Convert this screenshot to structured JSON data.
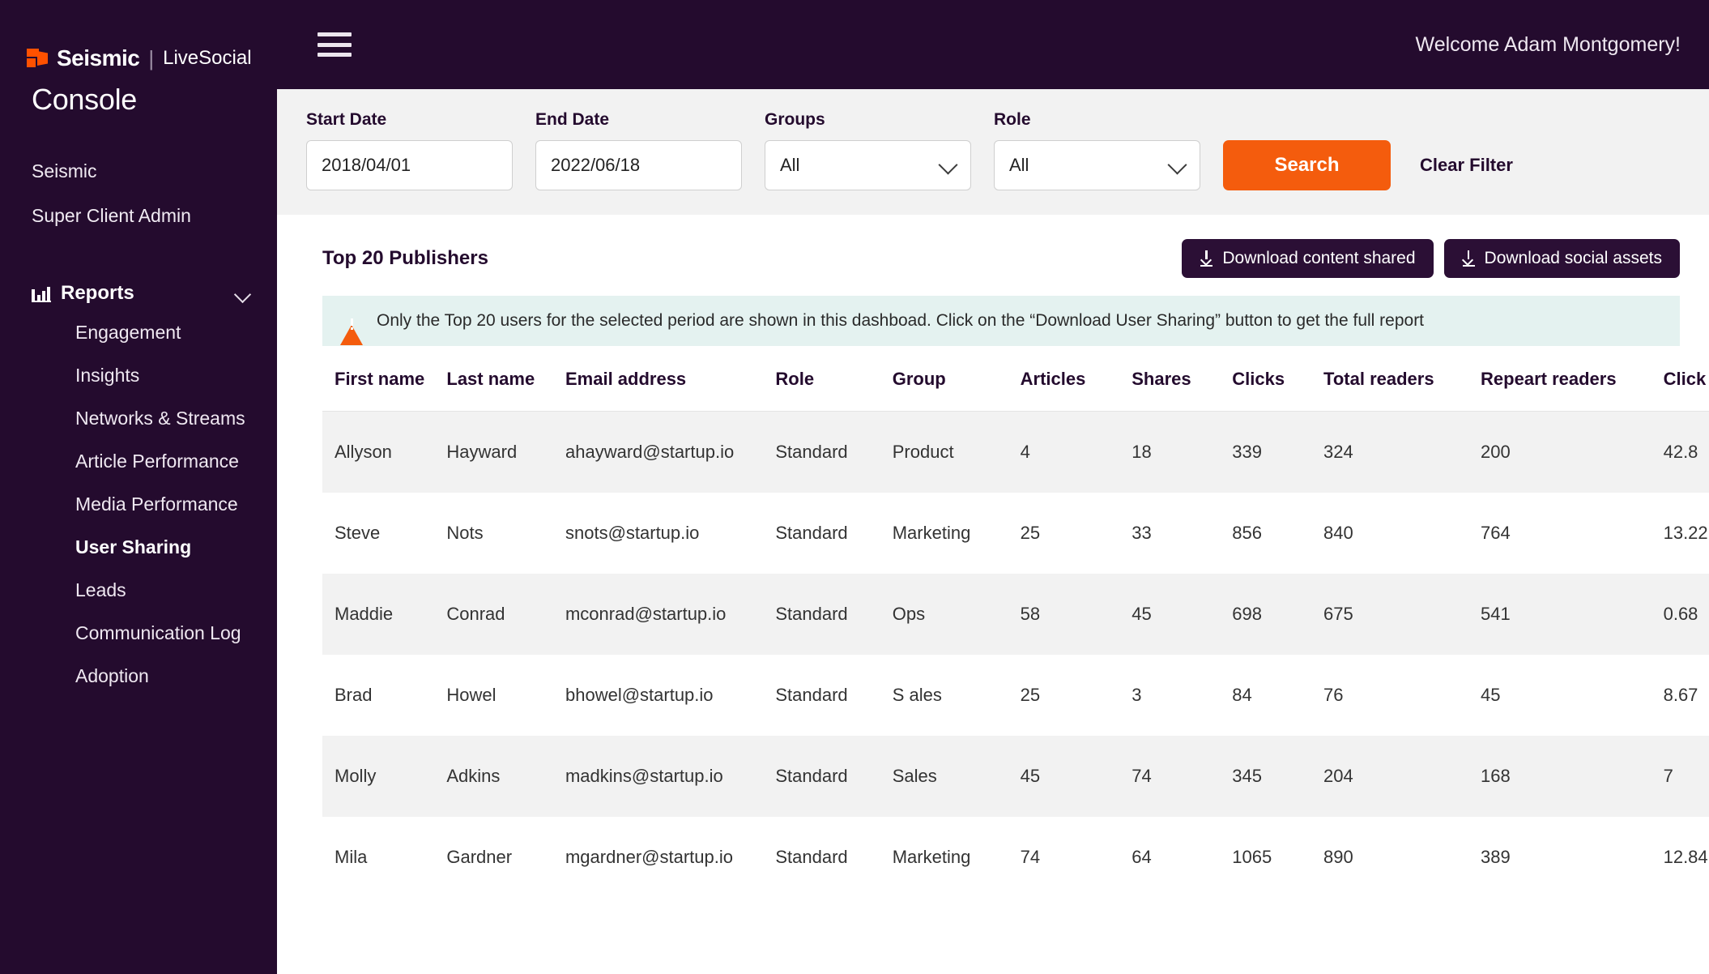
{
  "brand": {
    "name": "Seismic",
    "divider": "|",
    "product": "LiveSocial",
    "console": "Console"
  },
  "sidebar": {
    "top_items": [
      {
        "label": "Seismic"
      },
      {
        "label": "Super Client Admin"
      }
    ],
    "section": {
      "label": "Reports",
      "icon": "bar-chart-icon",
      "chevron": "chevron-down-icon"
    },
    "sub_items": [
      {
        "label": "Engagement",
        "active": false
      },
      {
        "label": "Insights",
        "active": false
      },
      {
        "label": "Networks & Streams",
        "active": false
      },
      {
        "label": "Article Performance",
        "active": false
      },
      {
        "label": "Media Performance",
        "active": false
      },
      {
        "label": "User Sharing",
        "active": true
      },
      {
        "label": "Leads",
        "active": false
      },
      {
        "label": "Communication Log",
        "active": false
      },
      {
        "label": "Adoption",
        "active": false
      }
    ]
  },
  "topbar": {
    "menu_icon": "hamburger-icon",
    "welcome": "Welcome Adam Montgomery!"
  },
  "filters": {
    "start_date": {
      "label": "Start Date",
      "value": "2018/04/01",
      "placeholder": "YYYY/MM/DD"
    },
    "end_date": {
      "label": "End Date",
      "value": "2022/06/18",
      "placeholder": "YYYY/MM/DD"
    },
    "groups": {
      "label": "Groups",
      "value": "All"
    },
    "role": {
      "label": "Role",
      "value": "All"
    },
    "search_label": "Search",
    "clear_label": "Clear Filter",
    "accent_color": "#F45C0D"
  },
  "panel": {
    "title": "Top 20 Publishers",
    "download_content_shared": "Download content shared",
    "download_social_assets": "Download social assets"
  },
  "alert": {
    "icon": "warning-icon",
    "text": "Only the Top 20 users for the selected period are shown in this dashboad. Click on the “Download User Sharing” button to get the full report",
    "background": "#E4F2F0"
  },
  "table": {
    "columns": [
      "First name",
      "Last name",
      "Email address",
      "Role",
      "Group",
      "Articles",
      "Shares",
      "Clicks",
      "Total readers",
      "Repeart readers",
      "Click to article ratio"
    ],
    "rows": [
      [
        "Allyson",
        "Hayward",
        "ahayward@startup.io",
        "Standard",
        "Product",
        "4",
        "18",
        "339",
        "324",
        "200",
        "42.8"
      ],
      [
        "Steve",
        "Nots",
        "snots@startup.io",
        "Standard",
        "Marketing",
        "25",
        "33",
        "856",
        "840",
        "764",
        "13.22"
      ],
      [
        "Maddie",
        "Conrad",
        "mconrad@startup.io",
        "Standard",
        "Ops",
        "58",
        "45",
        "698",
        "675",
        "541",
        "0.68"
      ],
      [
        "Brad",
        "Howel",
        "bhowel@startup.io",
        "Standard",
        "S ales",
        "25",
        "3",
        "84",
        "76",
        "45",
        "8.67"
      ],
      [
        "Molly",
        "Adkins",
        "madkins@startup.io",
        "Standard",
        "Sales",
        "45",
        "74",
        "345",
        "204",
        "168",
        "7"
      ],
      [
        "Mila",
        "Gardner",
        "mgardner@startup.io",
        "Standard",
        "Marketing",
        "74",
        "64",
        "1065",
        "890",
        "389",
        "12.84"
      ]
    ]
  }
}
